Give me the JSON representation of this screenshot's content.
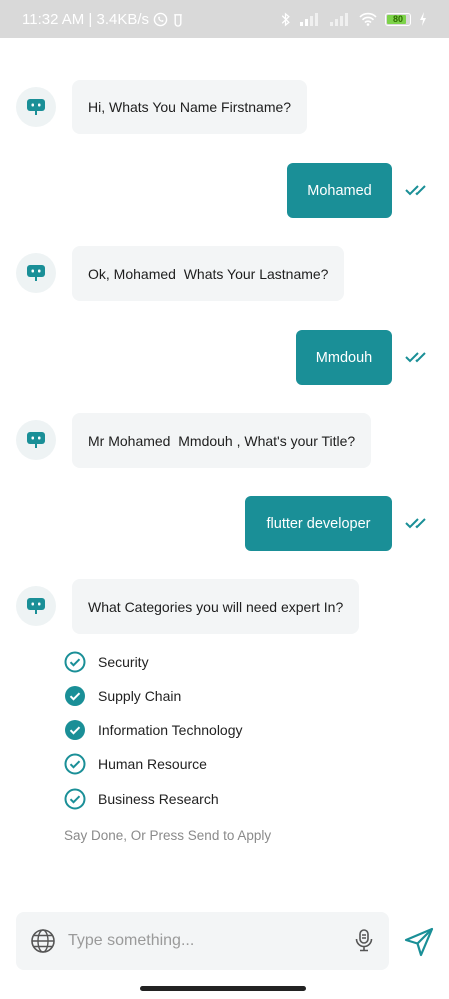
{
  "status_bar": {
    "time_and_speed": "11:32 AM | 3.4KB/s",
    "battery_level": "80"
  },
  "messages": [
    {
      "from": "bot",
      "text": "Hi, Whats You Name Firstname?"
    },
    {
      "from": "user",
      "text": "Mohamed"
    },
    {
      "from": "bot",
      "text": "Ok, Mohamed  Whats Your Lastname?"
    },
    {
      "from": "user",
      "text": "Mmdouh"
    },
    {
      "from": "bot",
      "text": "Mr Mohamed  Mmdouh , What's your Title?"
    },
    {
      "from": "user",
      "text": "flutter developer"
    },
    {
      "from": "bot",
      "text": "What Categories you will need expert In?"
    }
  ],
  "categories": [
    {
      "label": "Security",
      "selected": false
    },
    {
      "label": "Supply Chain",
      "selected": true
    },
    {
      "label": "Information Technology",
      "selected": true
    },
    {
      "label": "Human Resource",
      "selected": false
    },
    {
      "label": "Business Research",
      "selected": false
    }
  ],
  "hint": "Say Done, Or Press Send to Apply",
  "composer": {
    "placeholder": "Type something..."
  },
  "colors": {
    "accent": "#1a8f97",
    "bot_bubble": "#f3f5f6"
  }
}
